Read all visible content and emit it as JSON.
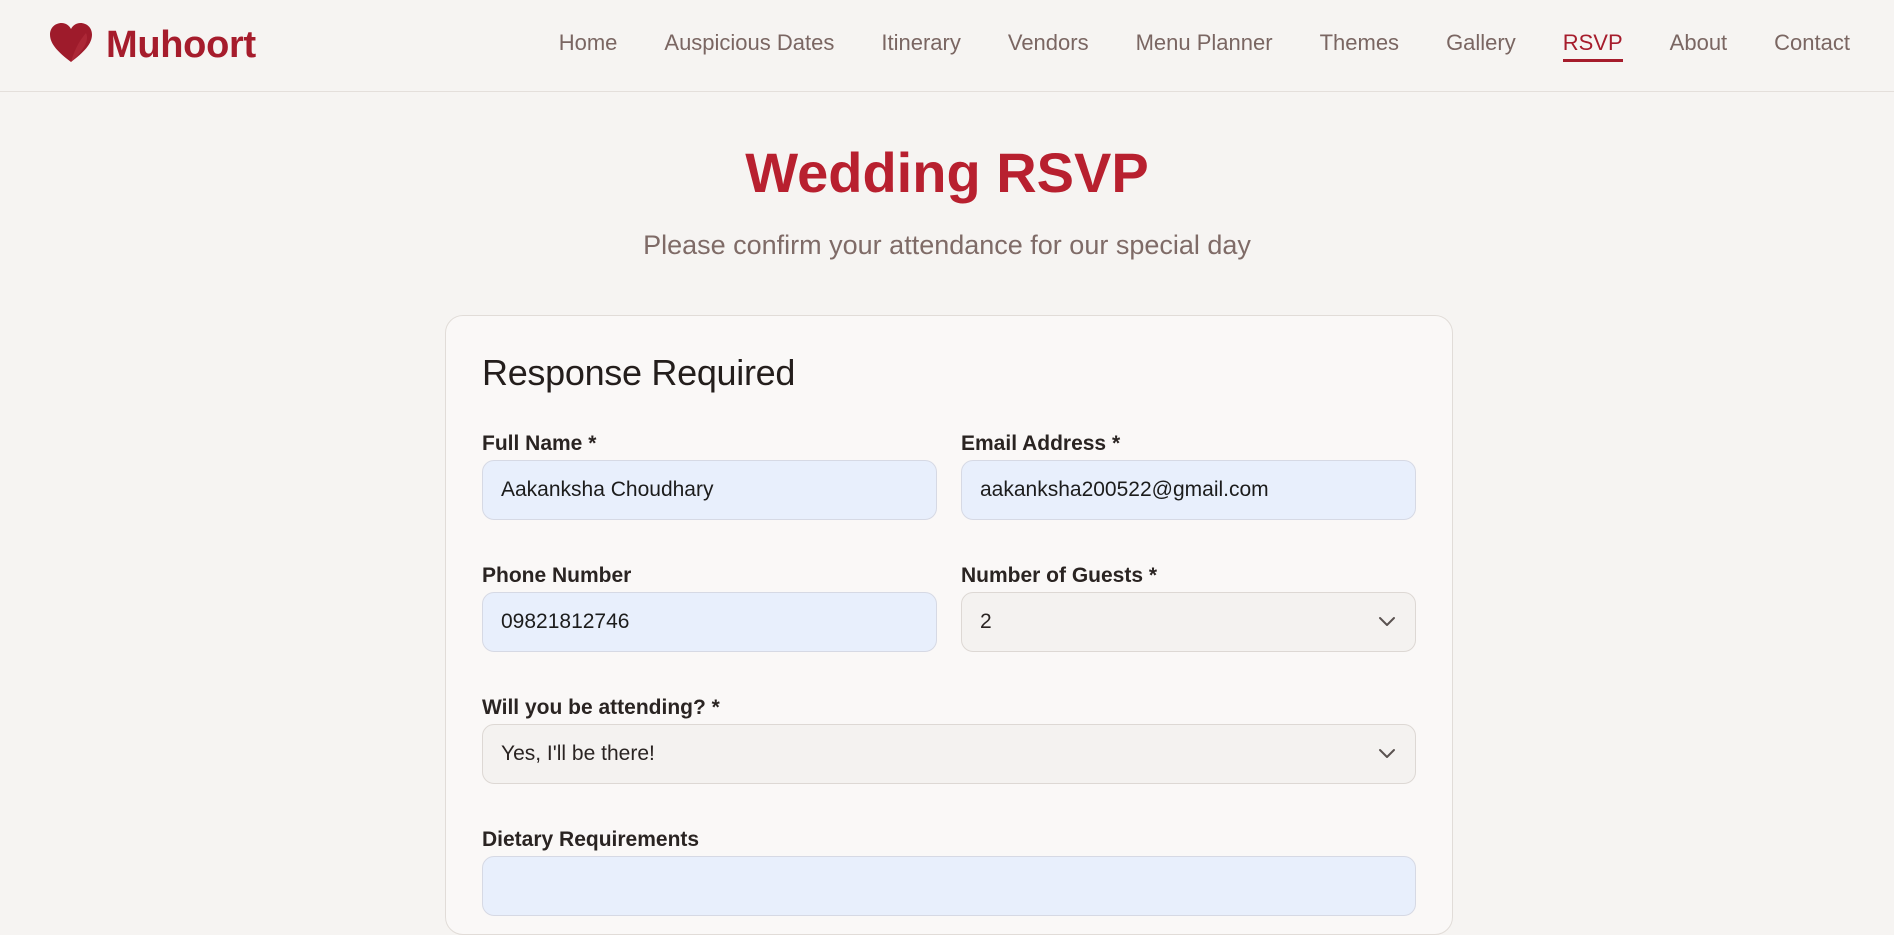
{
  "brand": {
    "name": "Muhoort",
    "icon": "heart-icon",
    "color": "#a61c2c"
  },
  "nav": {
    "items": [
      {
        "label": "Home",
        "active": false
      },
      {
        "label": "Auspicious Dates",
        "active": false
      },
      {
        "label": "Itinerary",
        "active": false
      },
      {
        "label": "Vendors",
        "active": false
      },
      {
        "label": "Menu Planner",
        "active": false
      },
      {
        "label": "Themes",
        "active": false
      },
      {
        "label": "Gallery",
        "active": false
      },
      {
        "label": "RSVP",
        "active": true
      },
      {
        "label": "About",
        "active": false
      },
      {
        "label": "Contact",
        "active": false
      }
    ]
  },
  "page": {
    "title": "Wedding RSVP",
    "subtitle": "Please confirm your attendance for our special day"
  },
  "form": {
    "title": "Response Required",
    "full_name": {
      "label": "Full Name *",
      "value": "Aakanksha Choudhary"
    },
    "email": {
      "label": "Email Address *",
      "value": "aakanksha200522@gmail.com"
    },
    "phone": {
      "label": "Phone Number",
      "value": "09821812746"
    },
    "guests": {
      "label": "Number of Guests *",
      "value": "2"
    },
    "attending": {
      "label": "Will you be attending? *",
      "value": "Yes, I'll be there!"
    },
    "dietary": {
      "label": "Dietary Requirements",
      "value": ""
    }
  },
  "colors": {
    "accent": "#a61c2c",
    "title": "#b8202f",
    "background": "#f6f4f2",
    "autofill": "#e8effc"
  }
}
